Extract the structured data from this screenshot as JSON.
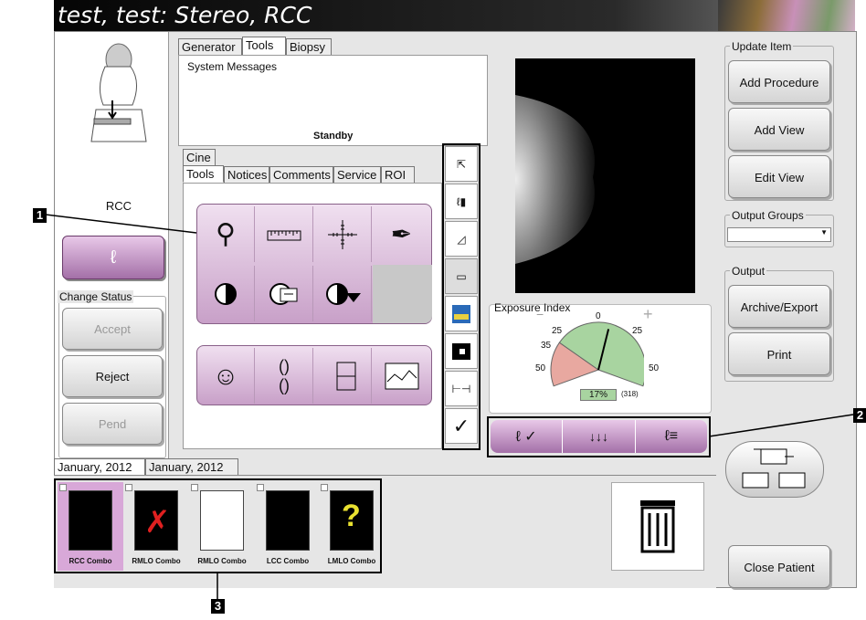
{
  "title": "test, test:  Stereo, RCC",
  "left": {
    "view_label": "RCC",
    "change_status_label": "Change Status",
    "accept_label": "Accept",
    "reject_label": "Reject",
    "pend_label": "Pend"
  },
  "top_tabs": [
    "Generator",
    "Tools",
    "Biopsy"
  ],
  "system_messages": {
    "label": "System Messages",
    "status": "Standby"
  },
  "sub_tabs": {
    "cine": "Cine",
    "tabs": [
      "Tools",
      "Notices",
      "Comments",
      "Service",
      "ROI"
    ]
  },
  "exposure": {
    "label": "Exposure Index",
    "ticks": {
      "t0": "0",
      "t25l": "25",
      "t25r": "25",
      "t35": "35",
      "t50l": "50",
      "t50r": "50"
    },
    "percent": "17%",
    "value": "(318)",
    "minus": "−",
    "plus": "+",
    "level": 0.17
  },
  "right": {
    "update_item_label": "Update Item",
    "add_procedure": "Add Procedure",
    "add_view": "Add View",
    "edit_view": "Edit View",
    "output_groups_label": "Output Groups",
    "output_label": "Output",
    "archive_export": "Archive/Export",
    "print": "Print",
    "close_patient": "Close Patient"
  },
  "date_tabs": [
    "January, 2012",
    "January, 2012"
  ],
  "thumbnails": [
    {
      "caption": "RCC Combo"
    },
    {
      "caption": "RMLO Combo"
    },
    {
      "caption": "RMLO Combo"
    },
    {
      "caption": "LCC Combo"
    },
    {
      "caption": "LMLO Combo"
    }
  ],
  "unknown_mark": "?",
  "callouts": {
    "c1": "1",
    "c2": "2",
    "c3": "3"
  },
  "colors": {
    "accent_purple": "#a470a8",
    "light_purple": "#e8c8e8",
    "gauge_green": "#a8d4a0",
    "gauge_red": "#e8a8a0"
  }
}
